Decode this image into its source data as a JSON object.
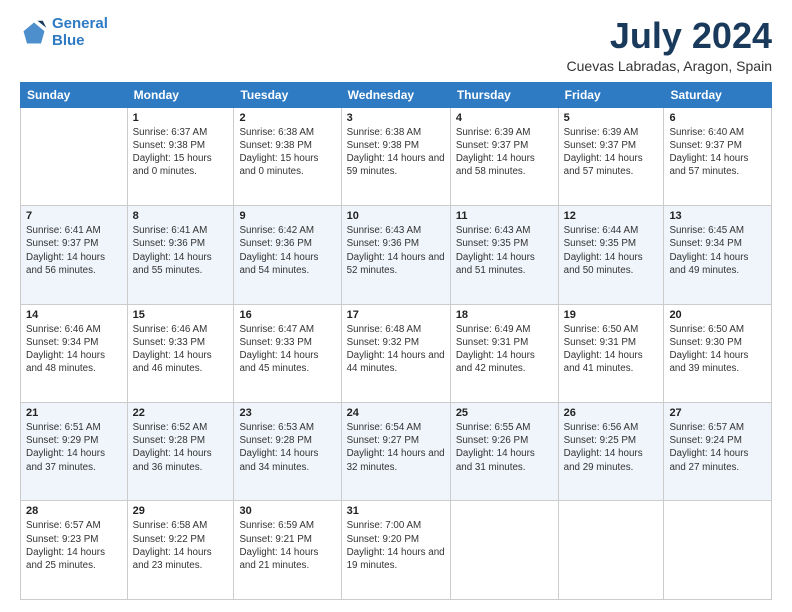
{
  "logo": {
    "line1": "General",
    "line2": "Blue"
  },
  "header": {
    "month": "July 2024",
    "location": "Cuevas Labradas, Aragon, Spain"
  },
  "weekdays": [
    "Sunday",
    "Monday",
    "Tuesday",
    "Wednesday",
    "Thursday",
    "Friday",
    "Saturday"
  ],
  "weeks": [
    [
      {
        "day": "",
        "sunrise": "",
        "sunset": "",
        "daylight": ""
      },
      {
        "day": "1",
        "sunrise": "Sunrise: 6:37 AM",
        "sunset": "Sunset: 9:38 PM",
        "daylight": "Daylight: 15 hours and 0 minutes."
      },
      {
        "day": "2",
        "sunrise": "Sunrise: 6:38 AM",
        "sunset": "Sunset: 9:38 PM",
        "daylight": "Daylight: 15 hours and 0 minutes."
      },
      {
        "day": "3",
        "sunrise": "Sunrise: 6:38 AM",
        "sunset": "Sunset: 9:38 PM",
        "daylight": "Daylight: 14 hours and 59 minutes."
      },
      {
        "day": "4",
        "sunrise": "Sunrise: 6:39 AM",
        "sunset": "Sunset: 9:37 PM",
        "daylight": "Daylight: 14 hours and 58 minutes."
      },
      {
        "day": "5",
        "sunrise": "Sunrise: 6:39 AM",
        "sunset": "Sunset: 9:37 PM",
        "daylight": "Daylight: 14 hours and 57 minutes."
      },
      {
        "day": "6",
        "sunrise": "Sunrise: 6:40 AM",
        "sunset": "Sunset: 9:37 PM",
        "daylight": "Daylight: 14 hours and 57 minutes."
      }
    ],
    [
      {
        "day": "7",
        "sunrise": "Sunrise: 6:41 AM",
        "sunset": "Sunset: 9:37 PM",
        "daylight": "Daylight: 14 hours and 56 minutes."
      },
      {
        "day": "8",
        "sunrise": "Sunrise: 6:41 AM",
        "sunset": "Sunset: 9:36 PM",
        "daylight": "Daylight: 14 hours and 55 minutes."
      },
      {
        "day": "9",
        "sunrise": "Sunrise: 6:42 AM",
        "sunset": "Sunset: 9:36 PM",
        "daylight": "Daylight: 14 hours and 54 minutes."
      },
      {
        "day": "10",
        "sunrise": "Sunrise: 6:43 AM",
        "sunset": "Sunset: 9:36 PM",
        "daylight": "Daylight: 14 hours and 52 minutes."
      },
      {
        "day": "11",
        "sunrise": "Sunrise: 6:43 AM",
        "sunset": "Sunset: 9:35 PM",
        "daylight": "Daylight: 14 hours and 51 minutes."
      },
      {
        "day": "12",
        "sunrise": "Sunrise: 6:44 AM",
        "sunset": "Sunset: 9:35 PM",
        "daylight": "Daylight: 14 hours and 50 minutes."
      },
      {
        "day": "13",
        "sunrise": "Sunrise: 6:45 AM",
        "sunset": "Sunset: 9:34 PM",
        "daylight": "Daylight: 14 hours and 49 minutes."
      }
    ],
    [
      {
        "day": "14",
        "sunrise": "Sunrise: 6:46 AM",
        "sunset": "Sunset: 9:34 PM",
        "daylight": "Daylight: 14 hours and 48 minutes."
      },
      {
        "day": "15",
        "sunrise": "Sunrise: 6:46 AM",
        "sunset": "Sunset: 9:33 PM",
        "daylight": "Daylight: 14 hours and 46 minutes."
      },
      {
        "day": "16",
        "sunrise": "Sunrise: 6:47 AM",
        "sunset": "Sunset: 9:33 PM",
        "daylight": "Daylight: 14 hours and 45 minutes."
      },
      {
        "day": "17",
        "sunrise": "Sunrise: 6:48 AM",
        "sunset": "Sunset: 9:32 PM",
        "daylight": "Daylight: 14 hours and 44 minutes."
      },
      {
        "day": "18",
        "sunrise": "Sunrise: 6:49 AM",
        "sunset": "Sunset: 9:31 PM",
        "daylight": "Daylight: 14 hours and 42 minutes."
      },
      {
        "day": "19",
        "sunrise": "Sunrise: 6:50 AM",
        "sunset": "Sunset: 9:31 PM",
        "daylight": "Daylight: 14 hours and 41 minutes."
      },
      {
        "day": "20",
        "sunrise": "Sunrise: 6:50 AM",
        "sunset": "Sunset: 9:30 PM",
        "daylight": "Daylight: 14 hours and 39 minutes."
      }
    ],
    [
      {
        "day": "21",
        "sunrise": "Sunrise: 6:51 AM",
        "sunset": "Sunset: 9:29 PM",
        "daylight": "Daylight: 14 hours and 37 minutes."
      },
      {
        "day": "22",
        "sunrise": "Sunrise: 6:52 AM",
        "sunset": "Sunset: 9:28 PM",
        "daylight": "Daylight: 14 hours and 36 minutes."
      },
      {
        "day": "23",
        "sunrise": "Sunrise: 6:53 AM",
        "sunset": "Sunset: 9:28 PM",
        "daylight": "Daylight: 14 hours and 34 minutes."
      },
      {
        "day": "24",
        "sunrise": "Sunrise: 6:54 AM",
        "sunset": "Sunset: 9:27 PM",
        "daylight": "Daylight: 14 hours and 32 minutes."
      },
      {
        "day": "25",
        "sunrise": "Sunrise: 6:55 AM",
        "sunset": "Sunset: 9:26 PM",
        "daylight": "Daylight: 14 hours and 31 minutes."
      },
      {
        "day": "26",
        "sunrise": "Sunrise: 6:56 AM",
        "sunset": "Sunset: 9:25 PM",
        "daylight": "Daylight: 14 hours and 29 minutes."
      },
      {
        "day": "27",
        "sunrise": "Sunrise: 6:57 AM",
        "sunset": "Sunset: 9:24 PM",
        "daylight": "Daylight: 14 hours and 27 minutes."
      }
    ],
    [
      {
        "day": "28",
        "sunrise": "Sunrise: 6:57 AM",
        "sunset": "Sunset: 9:23 PM",
        "daylight": "Daylight: 14 hours and 25 minutes."
      },
      {
        "day": "29",
        "sunrise": "Sunrise: 6:58 AM",
        "sunset": "Sunset: 9:22 PM",
        "daylight": "Daylight: 14 hours and 23 minutes."
      },
      {
        "day": "30",
        "sunrise": "Sunrise: 6:59 AM",
        "sunset": "Sunset: 9:21 PM",
        "daylight": "Daylight: 14 hours and 21 minutes."
      },
      {
        "day": "31",
        "sunrise": "Sunrise: 7:00 AM",
        "sunset": "Sunset: 9:20 PM",
        "daylight": "Daylight: 14 hours and 19 minutes."
      },
      {
        "day": "",
        "sunrise": "",
        "sunset": "",
        "daylight": ""
      },
      {
        "day": "",
        "sunrise": "",
        "sunset": "",
        "daylight": ""
      },
      {
        "day": "",
        "sunrise": "",
        "sunset": "",
        "daylight": ""
      }
    ]
  ]
}
